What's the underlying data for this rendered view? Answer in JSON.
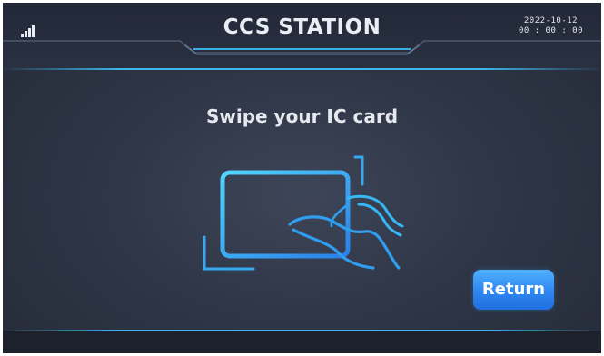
{
  "header": {
    "title": "CCS STATION",
    "date": "2022-10-12",
    "time": "00 : 00 : 00",
    "signal_icon": "signal-strength-icon"
  },
  "main": {
    "prompt": "Swipe your IC card",
    "illustration_icon": "swipe-card-icon"
  },
  "actions": {
    "return_label": "Return"
  },
  "colors": {
    "accent": "#2f86f0",
    "glow": "#3fc6ff",
    "background": "#2f3646"
  }
}
